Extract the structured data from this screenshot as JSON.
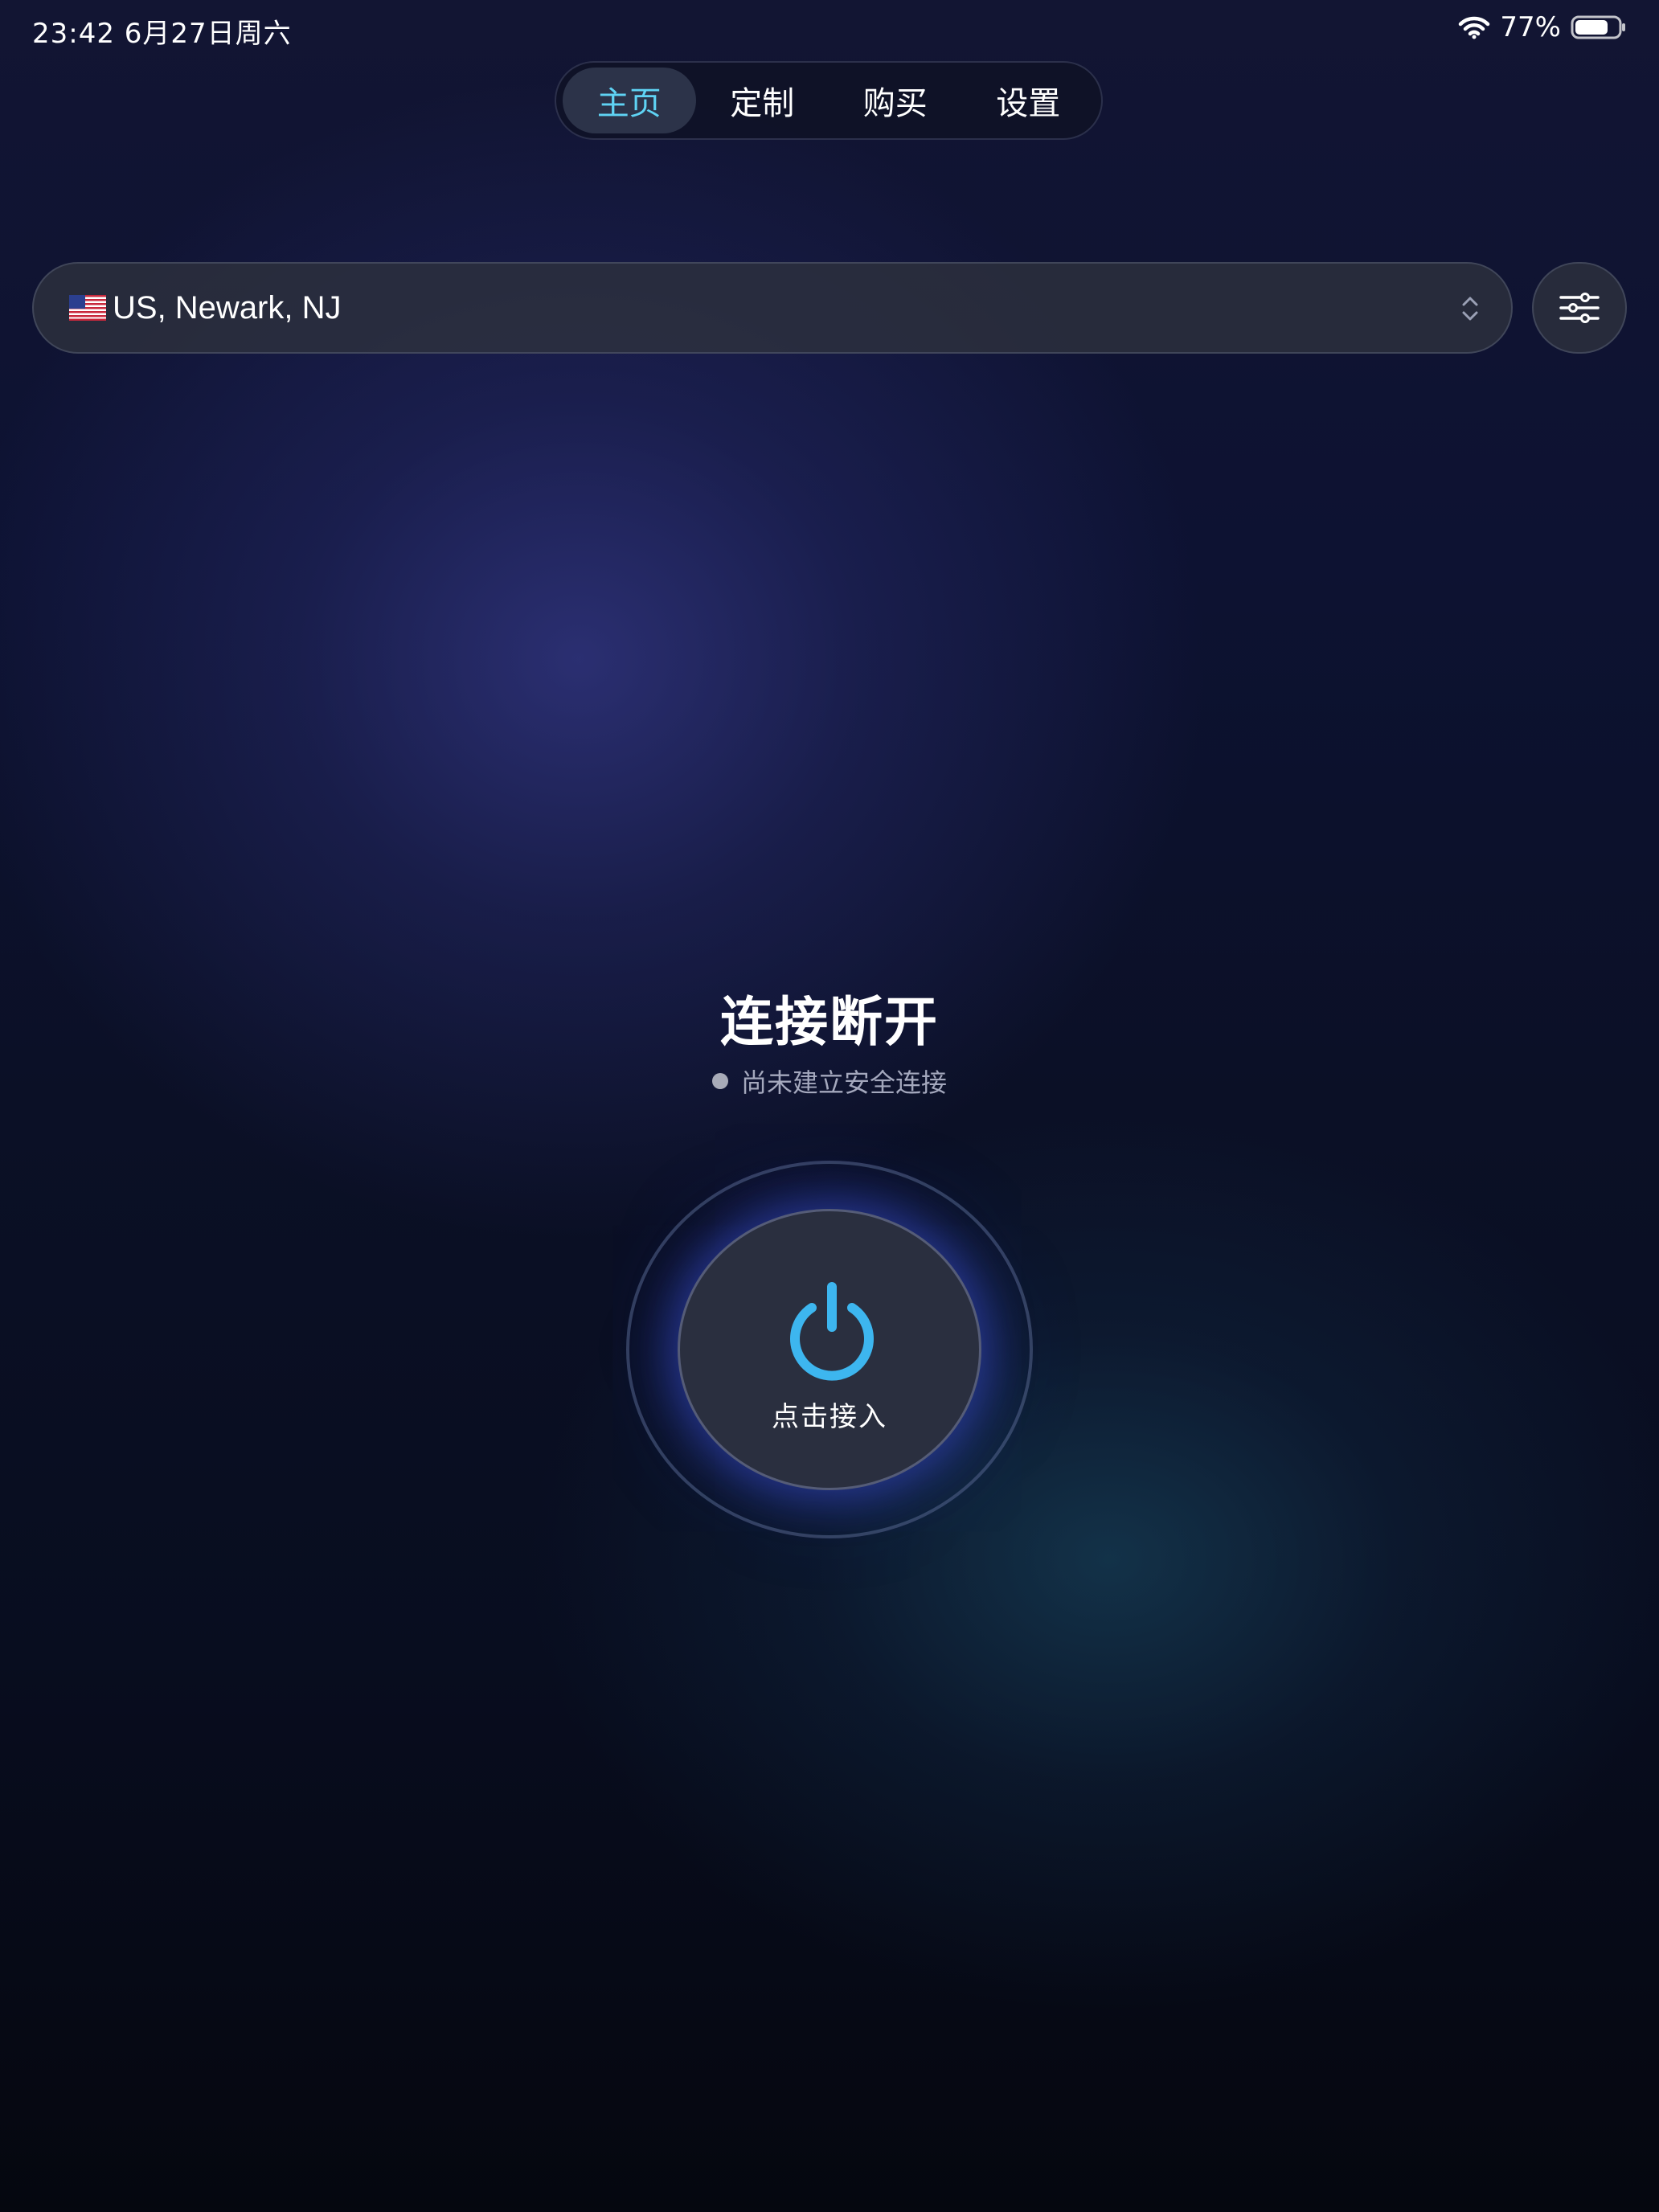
{
  "status_bar": {
    "time_date": "23:42  6月27日周六",
    "battery_percent": "77%",
    "battery_level": 0.77
  },
  "tabs": [
    {
      "label": "主页",
      "active": true
    },
    {
      "label": "定制",
      "active": false
    },
    {
      "label": "购买",
      "active": false
    },
    {
      "label": "设置",
      "active": false
    }
  ],
  "location": {
    "flag": "us-flag-icon",
    "label": "US, Newark, NJ"
  },
  "connection": {
    "title": "连接断开",
    "subtitle": "尚未建立安全连接",
    "button_label": "点击接入"
  },
  "colors": {
    "accent": "#5fd3f4",
    "power_icon": "#3db6ef",
    "status_dot": "#a8abb8"
  }
}
